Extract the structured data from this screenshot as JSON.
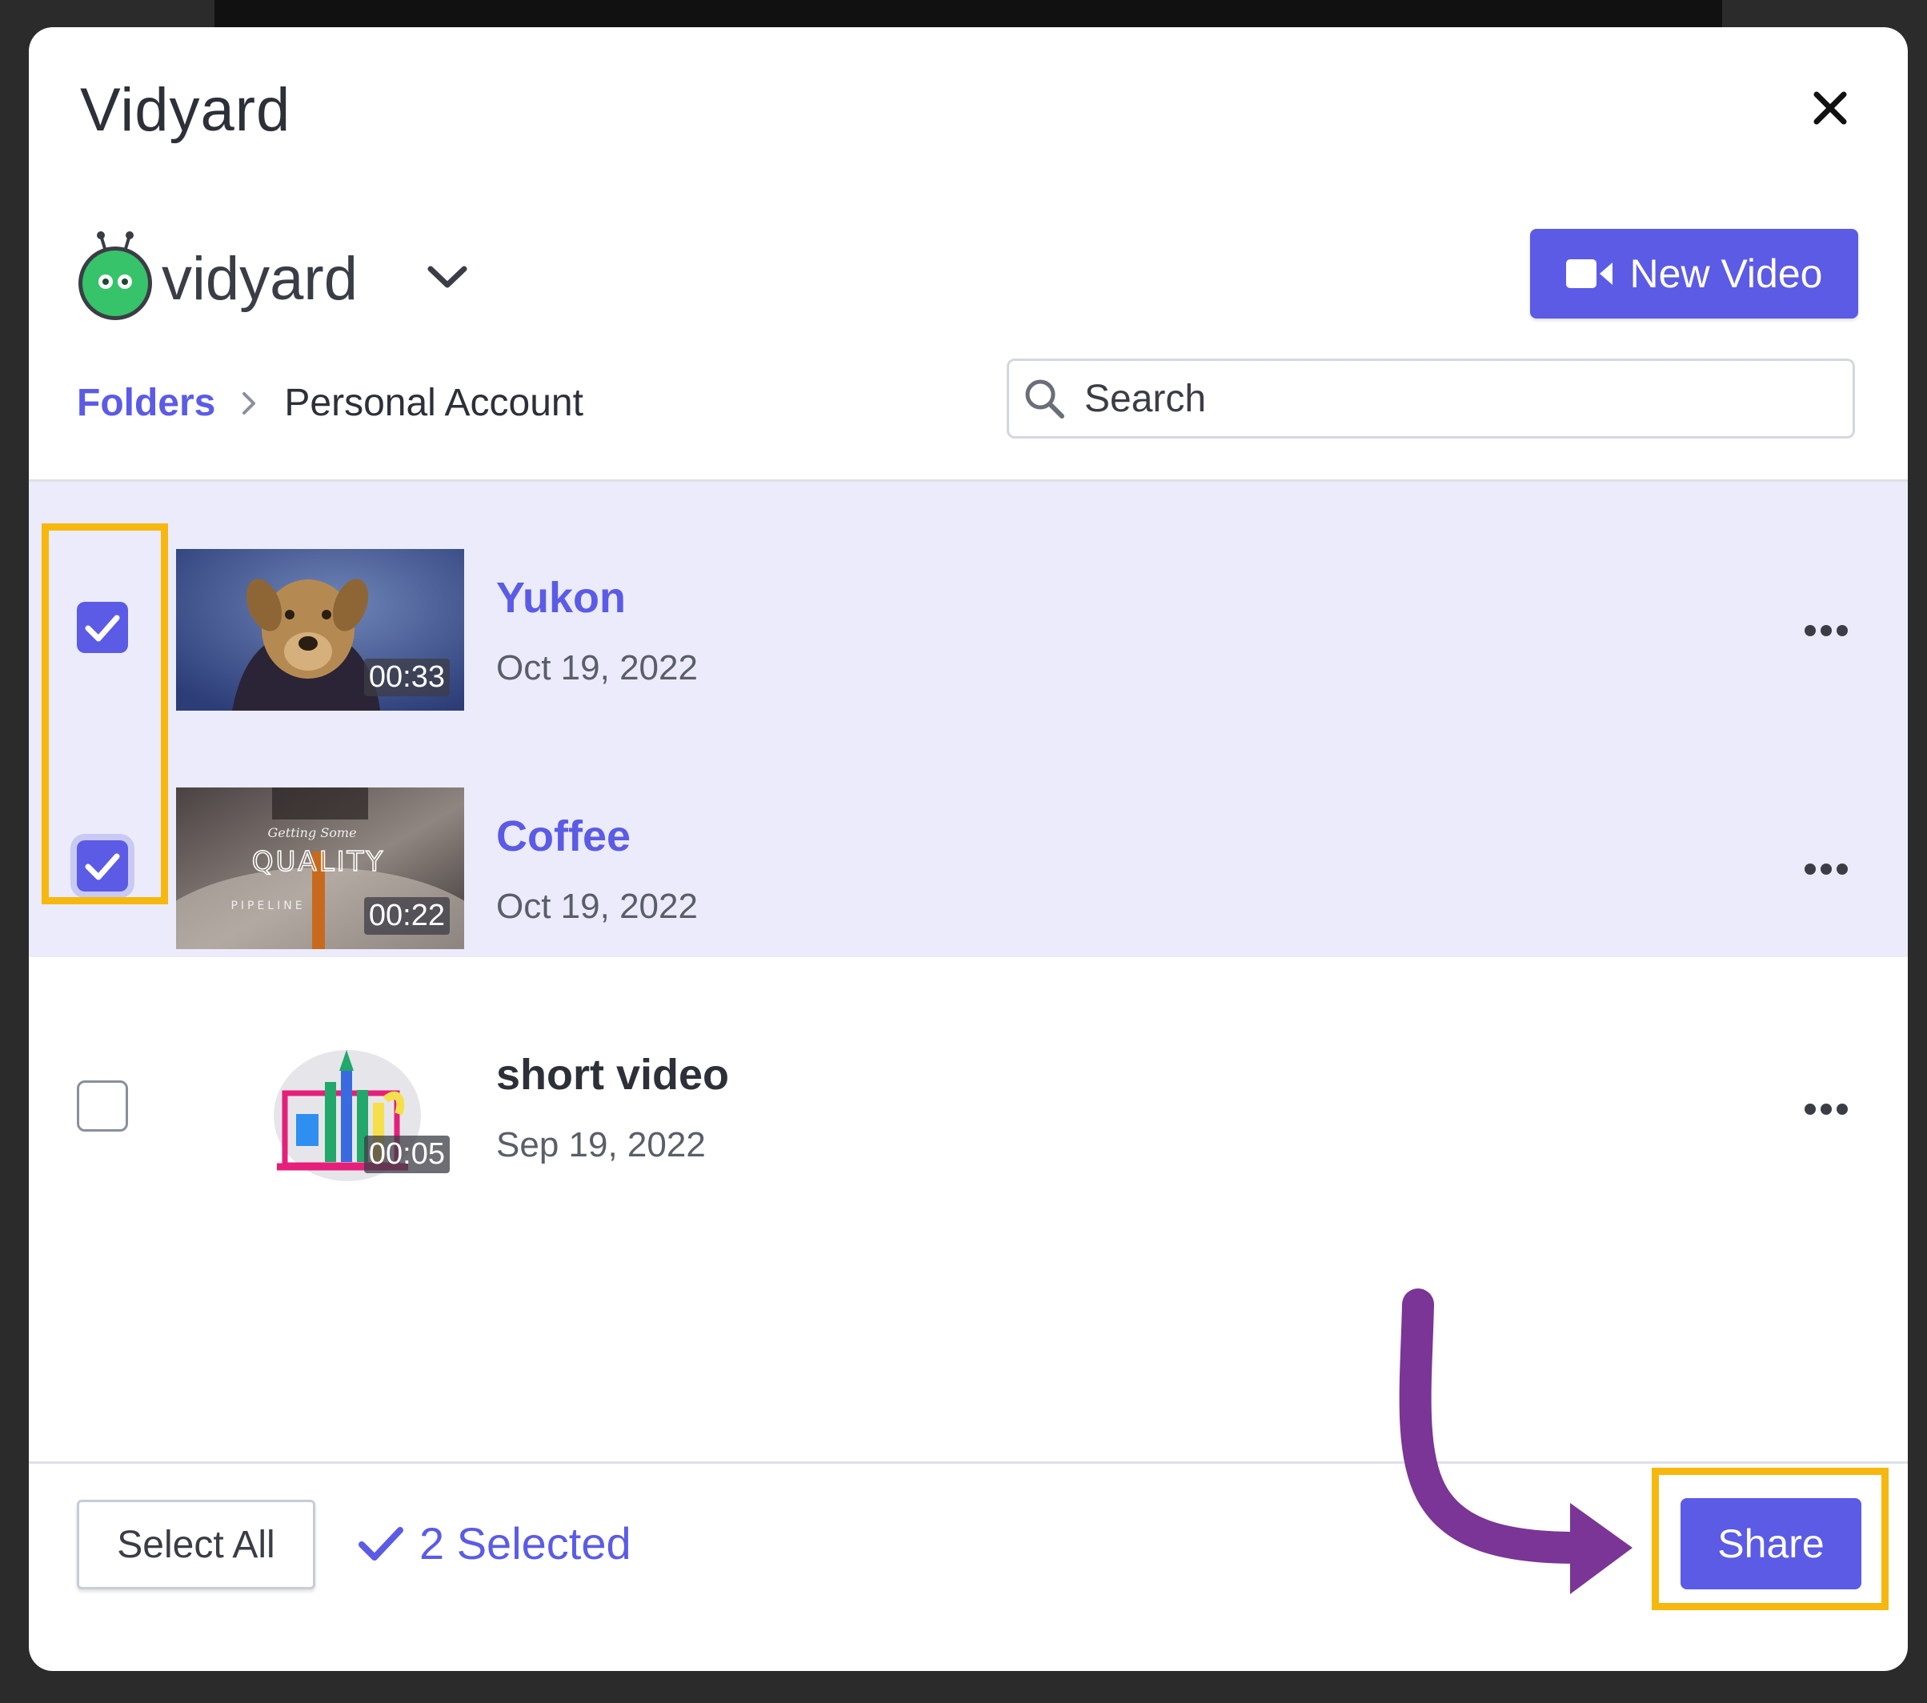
{
  "modal": {
    "title": "Vidyard",
    "close_icon": "close-icon"
  },
  "brand": {
    "logo_text": "vidyard",
    "accent_color": "#5b5be6",
    "logo_green": "#37c36a",
    "dropdown_icon": "chevron-down-icon"
  },
  "toolbar": {
    "new_video_label": "New Video",
    "new_video_icon": "video-camera-icon"
  },
  "breadcrumb": {
    "folders_label": "Folders",
    "current_label": "Personal Account"
  },
  "search": {
    "placeholder": "Search"
  },
  "videos": [
    {
      "title": "Yukon",
      "date": "Oct 19, 2022",
      "duration": "00:33",
      "selected": true
    },
    {
      "title": "Coffee",
      "date": "Oct 19, 2022",
      "duration": "00:22",
      "selected": true,
      "thumb_text_top": "Getting Some",
      "thumb_text_main": "QUALITY",
      "thumb_text_bottom": "PIPELINE"
    },
    {
      "title": "short video",
      "date": "Sep 19, 2022",
      "duration": "00:05",
      "selected": false
    }
  ],
  "footer": {
    "select_all_label": "Select All",
    "selected_count_label": "2 Selected",
    "share_label": "Share"
  },
  "annotation": {
    "highlight_color": "#f6b80e",
    "arrow_color": "#7a3596"
  }
}
